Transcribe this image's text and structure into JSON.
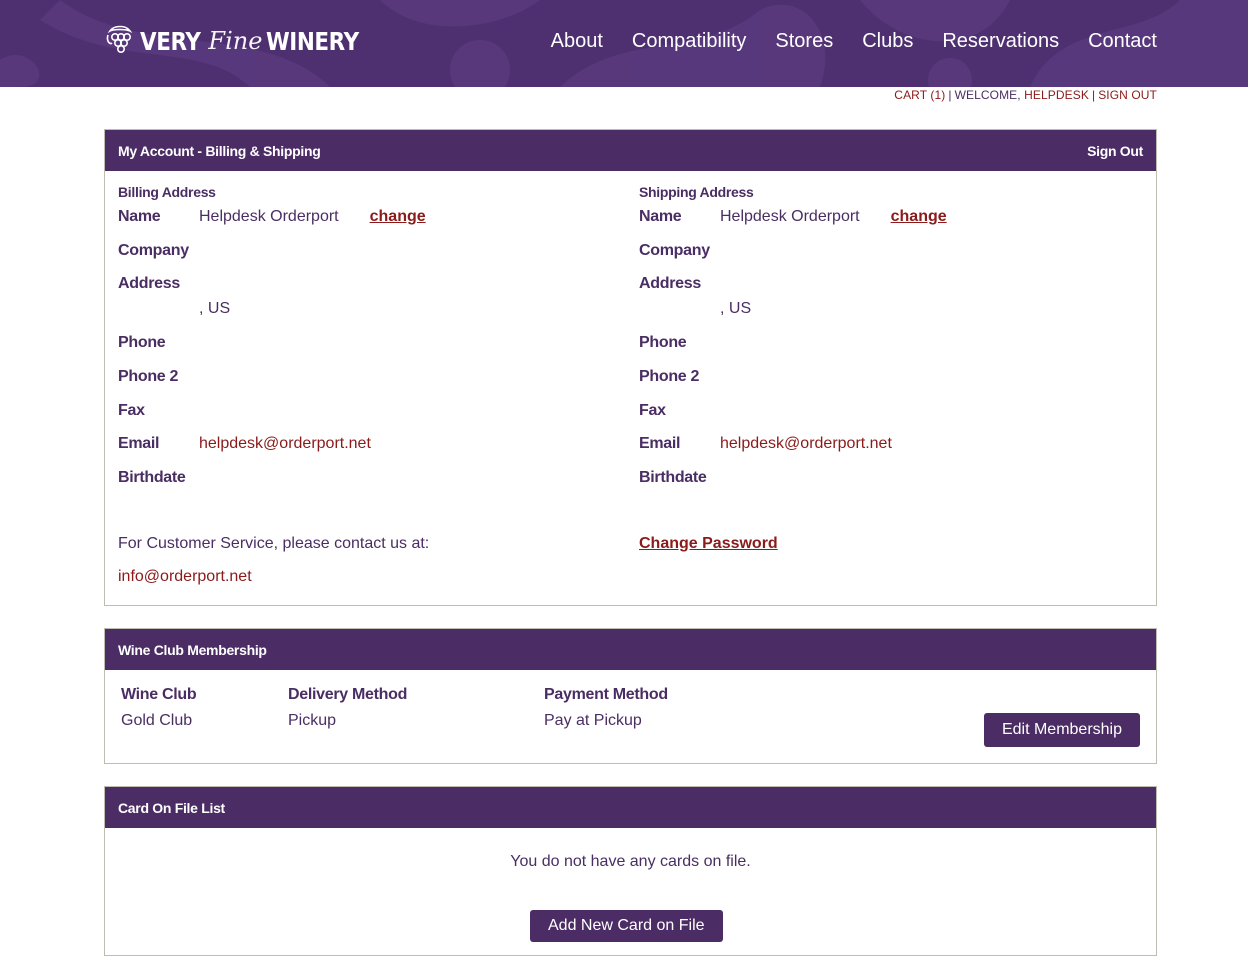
{
  "brand": {
    "very": "VERY",
    "fine": "Fine",
    "winery": "WINERY",
    "logo_icon": "grape-icon"
  },
  "nav": [
    "About",
    "Compatibility",
    "Stores",
    "Clubs",
    "Reservations",
    "Contact"
  ],
  "util": {
    "cart": "CART (1)",
    "welcome": "WELCOME,",
    "user": "HELPDESK",
    "signout": "SIGN OUT",
    "sep": "|"
  },
  "account": {
    "title": "My Account - Billing & Shipping",
    "signout": "Sign Out",
    "billing": {
      "title": "Billing Address",
      "name_label": "Name",
      "name": "Helpdesk Orderport",
      "change": "change",
      "company_label": "Company",
      "address_label": "Address",
      "address_line": ", US",
      "phone_label": "Phone",
      "phone2_label": "Phone 2",
      "fax_label": "Fax",
      "email_label": "Email",
      "email": "helpdesk@orderport.net",
      "birthdate_label": "Birthdate"
    },
    "shipping": {
      "title": "Shipping Address",
      "name_label": "Name",
      "name": "Helpdesk Orderport",
      "change": "change",
      "company_label": "Company",
      "address_label": "Address",
      "address_line": ", US",
      "phone_label": "Phone",
      "phone2_label": "Phone 2",
      "fax_label": "Fax",
      "email_label": "Email",
      "email": "helpdesk@orderport.net",
      "birthdate_label": "Birthdate"
    },
    "customer_service": "For Customer Service, please contact us at:",
    "cs_email": "info@orderport.net",
    "change_password": "Change Password"
  },
  "club": {
    "title": "Wine Club Membership",
    "headers": [
      "Wine Club",
      "Delivery Method",
      "Payment Method"
    ],
    "values": [
      "Gold Club",
      "Pickup",
      "Pay at Pickup"
    ],
    "edit_button": "Edit Membership"
  },
  "cards": {
    "title": "Card On File List",
    "empty": "You do not have any cards on file.",
    "add_button": "Add New Card on File"
  },
  "colors": {
    "header": "#4e3070",
    "panel_head": "#4b2c65",
    "link": "#8b1a1a",
    "text": "#4a2e63"
  }
}
